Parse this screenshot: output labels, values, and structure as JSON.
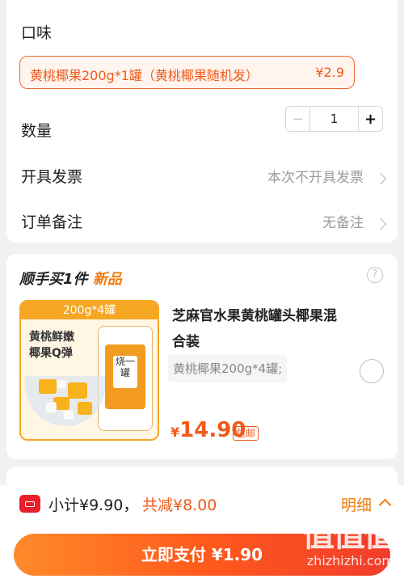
{
  "flavor": {
    "label": "口味",
    "option_name": "黄桃椰果200g*1罐（黄桃椰果随机发）",
    "option_price": "¥2.9"
  },
  "quantity": {
    "label": "数量",
    "value": "1",
    "minus": "−",
    "plus": "+"
  },
  "invoice": {
    "label": "开具发票",
    "value": "本次不开具发票"
  },
  "note": {
    "label": "订单备注",
    "value": "无备注"
  },
  "addon": {
    "title": "顺手买1件",
    "badge": "新品",
    "help": "?",
    "product": {
      "image_band": "200g*4罐",
      "image_slogan_1": "黄桃鲜嫩",
      "image_slogan_2": "椰果Q弹",
      "image_can_label": "烧一罐",
      "name": "芝麻官水果黄桃罐头椰果混合装",
      "spec": "黄桃椰果200g*4罐;",
      "currency": "¥",
      "price": "14.90",
      "shipping": "包邮"
    }
  },
  "footer": {
    "subtotal": "小计¥9.90，",
    "discount": "共减¥8.00",
    "detail": "明细",
    "pay_button": "立即支付 ¥1.90"
  },
  "watermark": {
    "logo": "值",
    "site": "zhizhizhi.com"
  },
  "colors": {
    "accent": "#f05a1a",
    "orange": "#f07a10",
    "brand_red": "#ea1f2c"
  }
}
